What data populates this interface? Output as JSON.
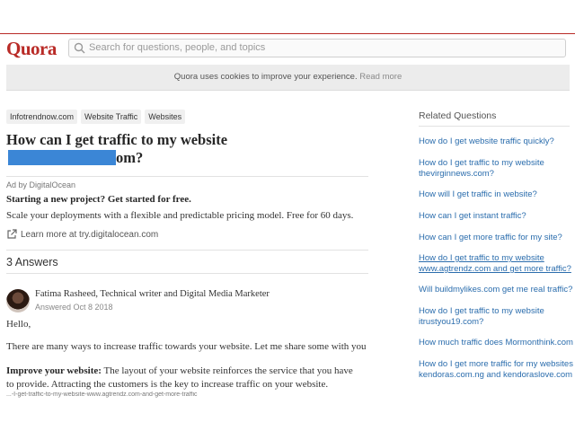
{
  "header": {
    "logo": "Quora",
    "search_placeholder": "Search for questions, people, and topics"
  },
  "cookie_banner": {
    "text": "Quora uses cookies to improve your experience.",
    "link": "Read more"
  },
  "question": {
    "topics": [
      "Infotrendnow.com",
      "Website Traffic",
      "Websites"
    ],
    "title_line1": "How can I get traffic to my website",
    "title_line2_suffix": "om?"
  },
  "ad": {
    "by": "Ad by DigitalOcean",
    "headline": "Starting a new project? Get started for free.",
    "body": "Scale your deployments with a flexible and predictable pricing model. Free for 60 days.",
    "link": "Learn more at try.digitalocean.com"
  },
  "answers": {
    "count_label": "3 Answers",
    "author": "Fatima Rasheed, Technical writer and Digital Media Marketer",
    "answered": "Answered Oct 8 2018",
    "greeting": "Hello,",
    "para1": "There are many ways to increase traffic towards your website. Let me share some with you",
    "para2_bold": "Improve your website:",
    "para2_rest": " The layout of your website reinforces the service that you have",
    "para2_line2": "to provide. Attracting the customers is the key to increase traffic on your website.",
    "cut_url": "...-I-get-traffic-to-my-website-www.agtrendz.com-and-get-more-traffic"
  },
  "related": {
    "title": "Related Questions",
    "items": [
      {
        "line1": "How do I get website traffic quickly?",
        "line2": ""
      },
      {
        "line1": "How do I get traffic to my website",
        "line2": "thevirginnews.com?"
      },
      {
        "line1": "How will I get traffic in website?",
        "line2": ""
      },
      {
        "line1": "How can I get instant traffic?",
        "line2": ""
      },
      {
        "line1": "How can I get more traffic for my site?",
        "line2": ""
      },
      {
        "line1": "How do I get traffic to my website",
        "line2": "www.agtrendz.com and get more traffic?"
      },
      {
        "line1": "Will buildmylikes.com get me real traffic?",
        "line2": ""
      },
      {
        "line1": "How do I get traffic to my website",
        "line2": "itrustyou19.com?"
      },
      {
        "line1": "How much traffic does Mormonthink.com",
        "line2": ""
      },
      {
        "line1": "How do I get more traffic for my websites",
        "line2": "kendoras.com.ng and kendoraslove.com"
      }
    ]
  }
}
